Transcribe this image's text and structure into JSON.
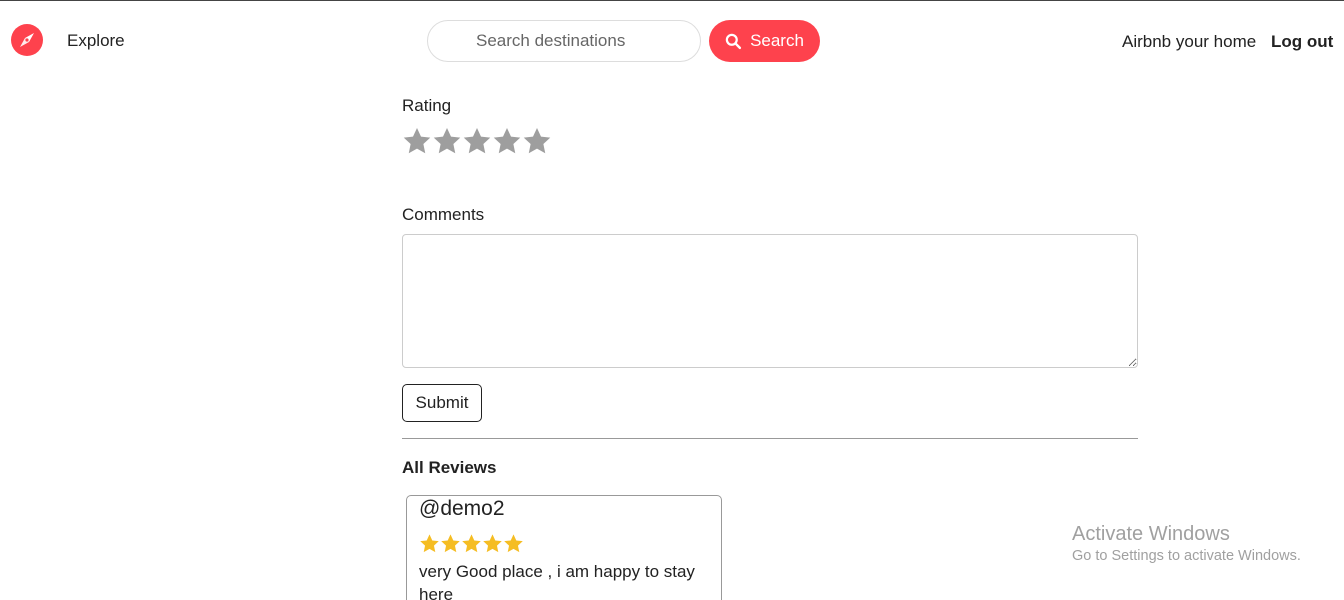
{
  "colors": {
    "brand": "#fe424d",
    "rating_star_empty": "#9e9e9e",
    "review_star": "#f5bd23"
  },
  "navbar": {
    "logo_icon": "compass-icon",
    "explore_label": "Explore",
    "search": {
      "placeholder": "Search destinations",
      "button_label": "Search",
      "button_icon": "search-icon"
    },
    "host_link": "Airbnb your home",
    "logout_link": "Log out"
  },
  "review_form": {
    "rating_label": "Rating",
    "rating_value": 0,
    "rating_max": 5,
    "comments_label": "Comments",
    "comments_value": "",
    "submit_label": "Submit"
  },
  "reviews": {
    "heading": "All Reviews",
    "items": [
      {
        "author": "@demo2",
        "rating": 5,
        "comment": "very Good place , i am happy to stay here"
      }
    ]
  },
  "watermark": {
    "title": "Activate Windows",
    "subtitle": "Go to Settings to activate Windows."
  }
}
